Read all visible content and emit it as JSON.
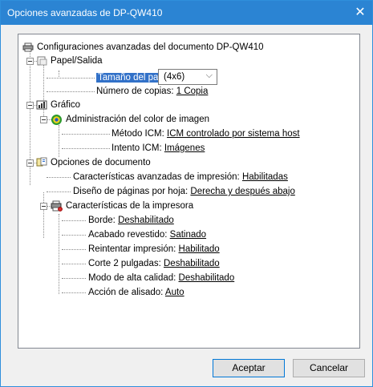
{
  "window": {
    "title": "Opciones avanzadas de DP-QW410",
    "close_glyph": "✕"
  },
  "tree": {
    "root_label": "Configuraciones avanzadas del documento DP-QW410",
    "paper_output": {
      "label": "Papel/Salida",
      "paper_size_label": "Tamaño del papel:",
      "paper_size_value": "(4x6)",
      "copies_label": "Número de copias:",
      "copies_value": "1 Copia"
    },
    "graphics": {
      "label": "Gráfico",
      "color_management": {
        "label": "Administración del color de imagen",
        "icm_method_label": "Método ICM:",
        "icm_method_value": "ICM controlado por sistema host",
        "icm_intent_label": "Intento ICM:",
        "icm_intent_value": "Imágenes"
      }
    },
    "document_options": {
      "label": "Opciones de documento",
      "adv_print_label": "Características avanzadas de impresión:",
      "adv_print_value": "Habilitadas",
      "page_layout_label": "Diseño de páginas por hoja:",
      "page_layout_value": "Derecha y después abajo",
      "printer_features": {
        "label": "Características de la impresora",
        "items": [
          {
            "label": "Borde:",
            "value": "Deshabilitado"
          },
          {
            "label": "Acabado revestido:",
            "value": "Satinado"
          },
          {
            "label": "Reintentar impresión:",
            "value": "Habilitado"
          },
          {
            "label": "Corte 2 pulgadas:",
            "value": "Deshabilitado"
          },
          {
            "label": "Modo de alta calidad:",
            "value": "Deshabilitado"
          },
          {
            "label": "Acción de alisado:",
            "value": "Auto"
          }
        ]
      }
    }
  },
  "buttons": {
    "accept": "Aceptar",
    "cancel": "Cancelar"
  },
  "colors": {
    "titlebar": "#2b84d3",
    "selection": "#3271c8"
  }
}
